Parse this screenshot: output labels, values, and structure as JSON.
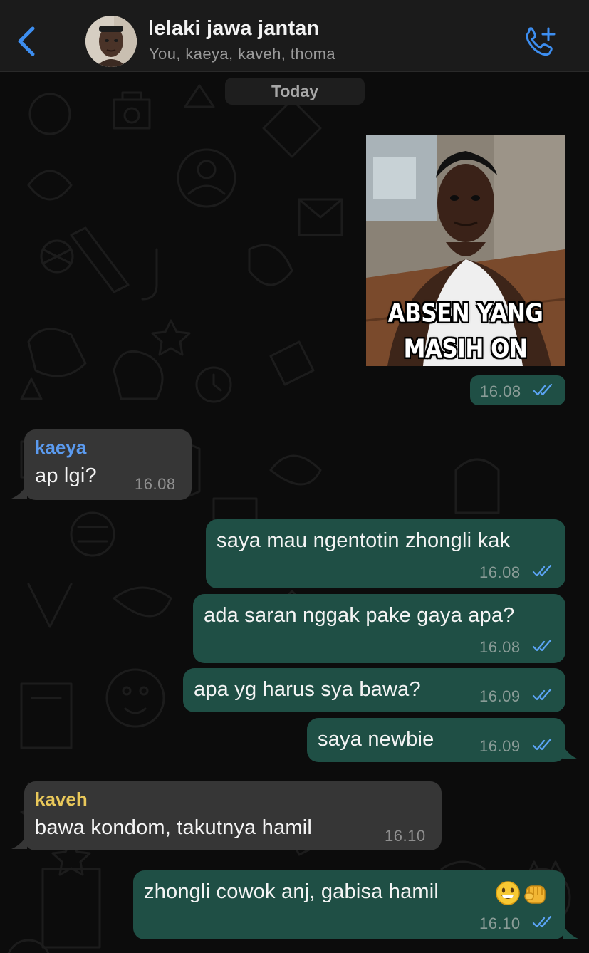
{
  "header": {
    "title": "lelaki jawa jantan",
    "members": "You, kaeya, kaveh, thoma"
  },
  "date_chip": "Today",
  "image_message": {
    "caption_line1": "ABSEN YANG",
    "caption_line2": "MASIH ON",
    "time": "16.08"
  },
  "messages": [
    {
      "direction": "in",
      "sender": "kaeya",
      "sender_color": "#5b9bf0",
      "text": "ap lgi?",
      "time": "16.08"
    },
    {
      "direction": "out",
      "text": "saya mau ngentotin zhongli kak",
      "time": "16.08"
    },
    {
      "direction": "out",
      "text": "ada saran nggak pake gaya apa?",
      "time": "16.08"
    },
    {
      "direction": "out",
      "text": "apa yg harus sya bawa?",
      "time": "16.09"
    },
    {
      "direction": "out",
      "text": "saya newbie",
      "time": "16.09"
    },
    {
      "direction": "in",
      "sender": "kaveh",
      "sender_color": "#e9c85a",
      "text": "bawa kondom, takutnya hamil",
      "time": "16.10"
    },
    {
      "direction": "out",
      "text": "zhongli cowok anj, gabisa hamil",
      "emoji": [
        "grinning-face",
        "oncoming-fist"
      ],
      "time": "16.10"
    }
  ],
  "colors": {
    "accent": "#3d8ef0",
    "outgoing_bubble": "#1f4f45",
    "incoming_bubble": "#363636",
    "read_ticks": "#5ba4f5"
  }
}
